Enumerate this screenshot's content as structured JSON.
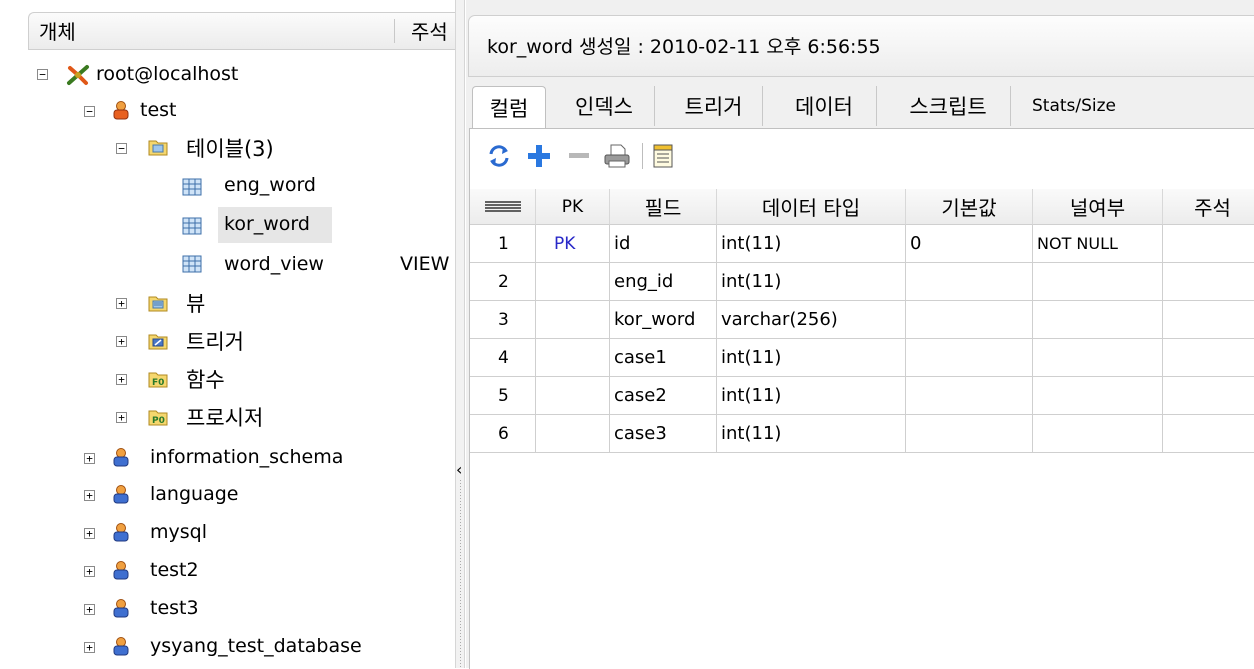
{
  "tree": {
    "header": {
      "object_col": "개체",
      "comment_col": "주석"
    },
    "nodes": {
      "server": {
        "label": "root@localhost",
        "toggle": "−"
      },
      "db_test": {
        "label": "test",
        "toggle": "−"
      },
      "tables_folder": {
        "label": "테이블(3)",
        "toggle": "−"
      },
      "table_eng_word": {
        "label": "eng_word"
      },
      "table_kor_word": {
        "label": "kor_word"
      },
      "table_word_view": {
        "label": "word_view",
        "comment": "VIEW"
      },
      "views_folder": {
        "label": "뷰",
        "toggle": "+"
      },
      "triggers_folder": {
        "label": "트리거",
        "toggle": "+"
      },
      "functions_folder": {
        "label": "함수",
        "toggle": "+"
      },
      "procedures_folder": {
        "label": "프로시저",
        "toggle": "+"
      },
      "db_information_schema": {
        "label": "information_schema",
        "toggle": "+"
      },
      "db_language": {
        "label": "language",
        "toggle": "+"
      },
      "db_mysql": {
        "label": "mysql",
        "toggle": "+"
      },
      "db_test2": {
        "label": "test2",
        "toggle": "+"
      },
      "db_test3": {
        "label": "test3",
        "toggle": "+"
      },
      "db_ysyang": {
        "label": "ysyang_test_database",
        "toggle": "+"
      }
    },
    "icon_labels": {
      "functions": "F0",
      "procedures": "P0"
    }
  },
  "splitter": {
    "arrow": "‹"
  },
  "info_bar": {
    "text": "kor_word  생성일 : 2010-02-11 오후 6:56:55"
  },
  "tabs": [
    {
      "label": "컬럼"
    },
    {
      "label": "인덱스"
    },
    {
      "label": "트리거"
    },
    {
      "label": "데이터"
    },
    {
      "label": "스크립트"
    },
    {
      "label": "Stats/Size"
    }
  ],
  "toolbar": {
    "refresh": "refresh-icon",
    "add": "add-icon",
    "remove": "remove-icon",
    "print": "print-icon",
    "properties": "properties-icon"
  },
  "grid": {
    "columns": [
      "PK",
      "필드",
      "데이터 타입",
      "기본값",
      "널여부",
      "주석"
    ],
    "rows": [
      {
        "num": "1",
        "pk": "PK",
        "field": "id",
        "type": "int(11)",
        "default": "0",
        "nullable": "NOT NULL",
        "comment": ""
      },
      {
        "num": "2",
        "pk": "",
        "field": "eng_id",
        "type": "int(11)",
        "default": "",
        "nullable": "",
        "comment": ""
      },
      {
        "num": "3",
        "pk": "",
        "field": "kor_word",
        "type": "varchar(256)",
        "default": "",
        "nullable": "",
        "comment": ""
      },
      {
        "num": "4",
        "pk": "",
        "field": "case1",
        "type": "int(11)",
        "default": "",
        "nullable": "",
        "comment": ""
      },
      {
        "num": "5",
        "pk": "",
        "field": "case2",
        "type": "int(11)",
        "default": "",
        "nullable": "",
        "comment": ""
      },
      {
        "num": "6",
        "pk": "",
        "field": "case3",
        "type": "int(11)",
        "default": "",
        "nullable": "",
        "comment": ""
      }
    ]
  },
  "colors": {
    "pk_text": "#2828c8",
    "selected_row": "#e6e6e6",
    "user_icon": "#e07020"
  }
}
